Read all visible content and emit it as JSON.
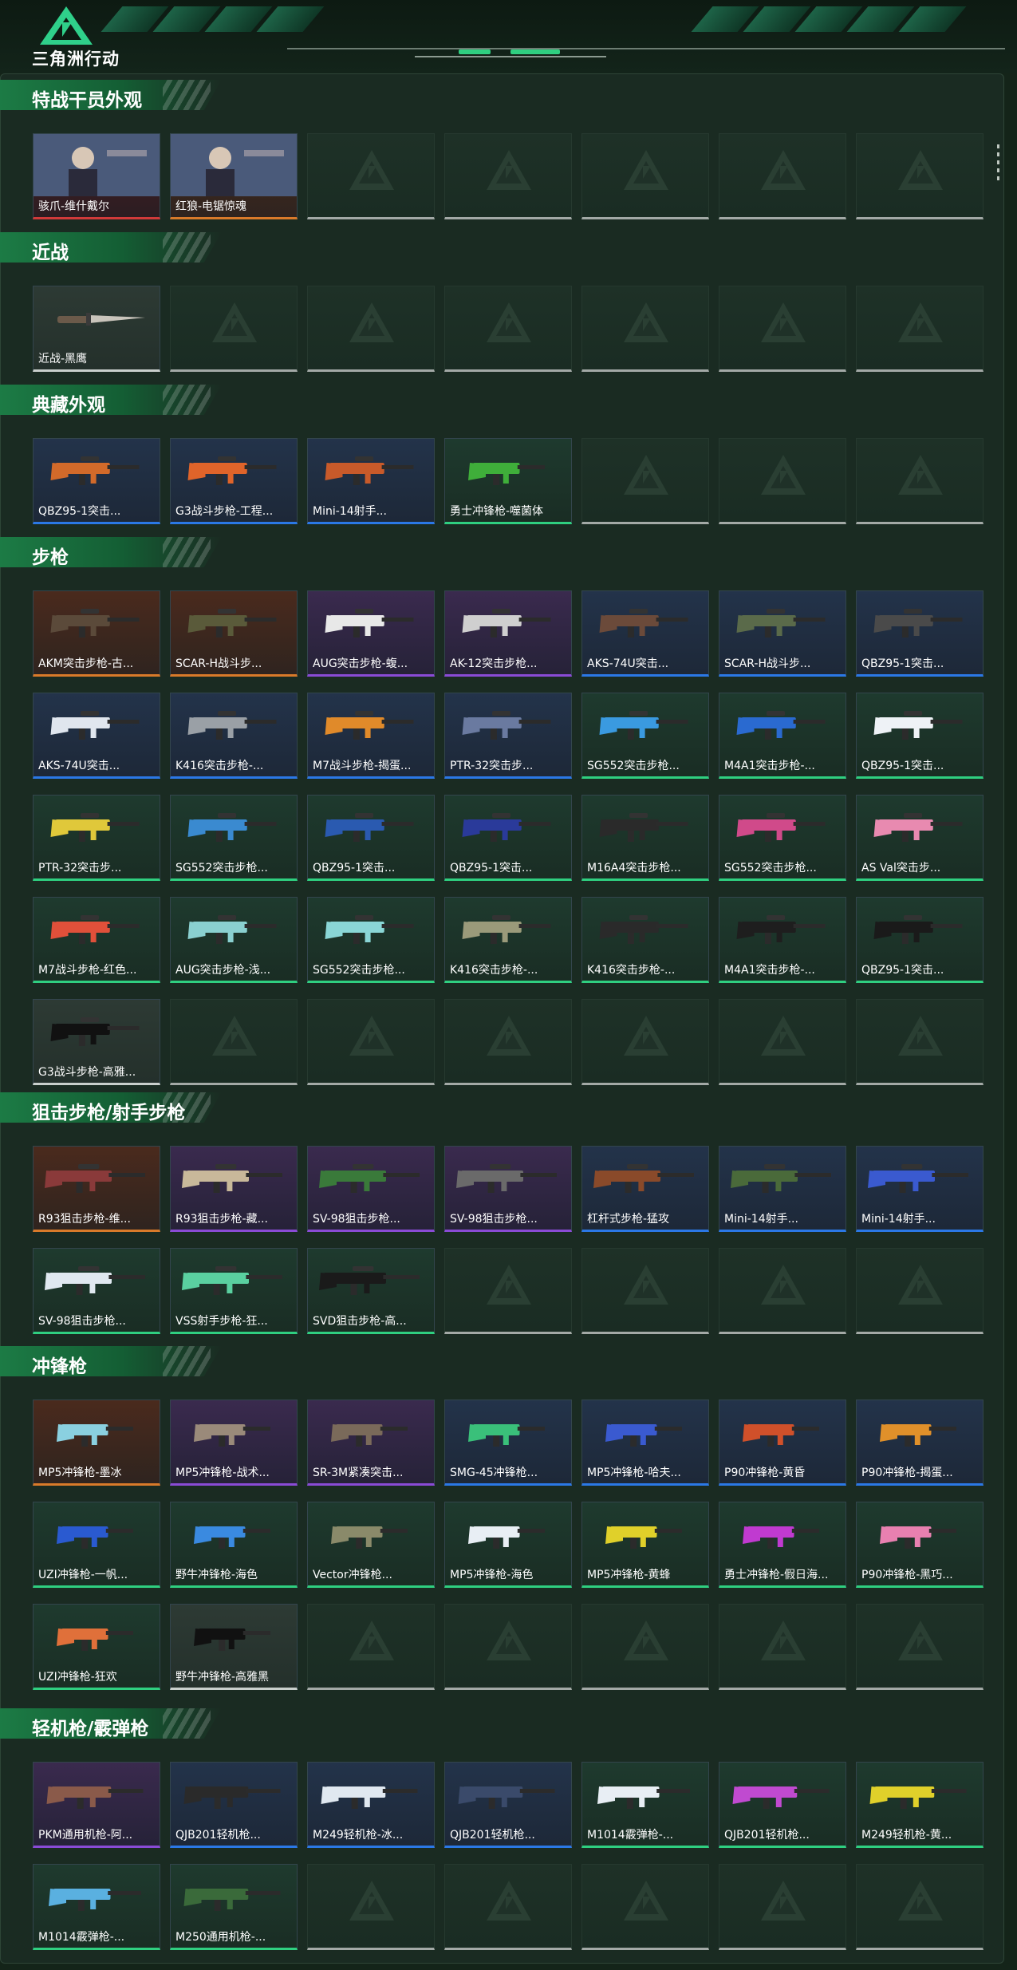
{
  "brand": {
    "name": "三角洲行动"
  },
  "colors": {
    "gold": "#d97a2a",
    "red": "#d13a3a",
    "purple": "#8a4bd6",
    "blue": "#2b78e6",
    "green": "#2fcf80",
    "white": "#c9cfcc",
    "empty": "#a3a9a6",
    "accent": "#1c7b45"
  },
  "sections": [
    {
      "title": "特战干员外观",
      "slots": 7,
      "items": [
        {
          "label": "骇爪-维什戴尔",
          "rarity": "red",
          "kind": "portrait"
        },
        {
          "label": "红狼-电锯惊魂",
          "rarity": "gold",
          "kind": "portrait"
        }
      ]
    },
    {
      "title": "近战",
      "slots": 7,
      "items": [
        {
          "label": "近战-黑鹰",
          "rarity": "white",
          "kind": "knife"
        }
      ]
    },
    {
      "title": "典藏外观",
      "slots": 7,
      "items": [
        {
          "label": "QBZ95-1突击...",
          "rarity": "blue",
          "kind": "rifle",
          "tint": "#d26a2a"
        },
        {
          "label": "G3战斗步枪-工程...",
          "rarity": "blue",
          "kind": "rifle",
          "tint": "#e0642a"
        },
        {
          "label": "Mini-14射手...",
          "rarity": "blue",
          "kind": "rifle",
          "tint": "#c85a2a"
        },
        {
          "label": "勇士冲锋枪-噬菌体",
          "rarity": "green",
          "kind": "smg",
          "tint": "#3fae3a"
        }
      ]
    },
    {
      "title": "步枪",
      "slots": 35,
      "items": [
        {
          "label": "AKM突击步枪-古...",
          "rarity": "gold",
          "kind": "rifle",
          "tint": "#5b4a3a"
        },
        {
          "label": "SCAR-H战斗步...",
          "rarity": "gold",
          "kind": "rifle",
          "tint": "#5a5a3a"
        },
        {
          "label": "AUG突击步枪-蝮...",
          "rarity": "purple",
          "kind": "rifle",
          "tint": "#e8e8e8"
        },
        {
          "label": "AK-12突击步枪...",
          "rarity": "purple",
          "kind": "rifle",
          "tint": "#cfcfcf"
        },
        {
          "label": "AKS-74U突击...",
          "rarity": "blue",
          "kind": "rifle",
          "tint": "#6b4a3a"
        },
        {
          "label": "SCAR-H战斗步...",
          "rarity": "blue",
          "kind": "rifle",
          "tint": "#5a6a4a"
        },
        {
          "label": "QBZ95-1突击...",
          "rarity": "blue",
          "kind": "rifle",
          "tint": "#4a4a4a"
        },
        {
          "label": "AKS-74U突击...",
          "rarity": "blue",
          "kind": "rifle",
          "tint": "#e0e6ee"
        },
        {
          "label": "K416突击步枪-...",
          "rarity": "blue",
          "kind": "rifle",
          "tint": "#9aa0a6"
        },
        {
          "label": "M7战斗步枪-揭蛋...",
          "rarity": "blue",
          "kind": "rifle",
          "tint": "#e08a2a"
        },
        {
          "label": "PTR-32突击步...",
          "rarity": "blue",
          "kind": "rifle",
          "tint": "#6a7aa0"
        },
        {
          "label": "SG552突击步枪...",
          "rarity": "green",
          "kind": "rifle",
          "tint": "#3a9ae0"
        },
        {
          "label": "M4A1突击步枪-...",
          "rarity": "green",
          "kind": "rifle",
          "tint": "#2a6ad0"
        },
        {
          "label": "QBZ95-1突击...",
          "rarity": "green",
          "kind": "rifle",
          "tint": "#eef2f6"
        },
        {
          "label": "PTR-32突击步...",
          "rarity": "green",
          "kind": "rifle",
          "tint": "#e0c83a"
        },
        {
          "label": "SG552突击步枪...",
          "rarity": "green",
          "kind": "rifle",
          "tint": "#3a8ad0"
        },
        {
          "label": "QBZ95-1突击...",
          "rarity": "green",
          "kind": "rifle",
          "tint": "#2a5ab0"
        },
        {
          "label": "QBZ95-1突击...",
          "rarity": "green",
          "kind": "rifle",
          "tint": "#2a3a9a"
        },
        {
          "label": "M16A4突击步枪...",
          "rarity": "green",
          "kind": "rifle",
          "tint": "#2a2a2a"
        },
        {
          "label": "SG552突击步枪...",
          "rarity": "green",
          "kind": "rifle",
          "tint": "#d04a8a"
        },
        {
          "label": "AS Val突击步...",
          "rarity": "green",
          "kind": "rifle",
          "tint": "#e88ab0"
        },
        {
          "label": "M7战斗步枪-红色...",
          "rarity": "green",
          "kind": "rifle",
          "tint": "#e0503a"
        },
        {
          "label": "AUG突击步枪-浅...",
          "rarity": "green",
          "kind": "rifle",
          "tint": "#8ad0d0"
        },
        {
          "label": "SG552突击步枪...",
          "rarity": "green",
          "kind": "rifle",
          "tint": "#8ad6d6"
        },
        {
          "label": "K416突击步枪-...",
          "rarity": "green",
          "kind": "rifle",
          "tint": "#9a9a7a"
        },
        {
          "label": "K416突击步枪-...",
          "rarity": "green",
          "kind": "rifle",
          "tint": "#2a2a2a"
        },
        {
          "label": "M4A1突击步枪-...",
          "rarity": "green",
          "kind": "rifle",
          "tint": "#1e1e1e"
        },
        {
          "label": "QBZ95-1突击...",
          "rarity": "green",
          "kind": "rifle",
          "tint": "#1a1a1a"
        },
        {
          "label": "G3战斗步枪-高雅...",
          "rarity": "white",
          "kind": "rifle",
          "tint": "#111111"
        }
      ]
    },
    {
      "title": "狙击步枪/射手步枪",
      "slots": 14,
      "items": [
        {
          "label": "R93狙击步枪-维...",
          "rarity": "gold",
          "kind": "sniper",
          "tint": "#8a3a3a"
        },
        {
          "label": "R93狙击步枪-藏...",
          "rarity": "purple",
          "kind": "sniper",
          "tint": "#c8b89a"
        },
        {
          "label": "SV-98狙击步枪...",
          "rarity": "purple",
          "kind": "sniper",
          "tint": "#3a7a3a"
        },
        {
          "label": "SV-98狙击步枪...",
          "rarity": "purple",
          "kind": "sniper",
          "tint": "#6a6a6a"
        },
        {
          "label": "杠杆式步枪-猛攻",
          "rarity": "blue",
          "kind": "sniper",
          "tint": "#8a4a2a"
        },
        {
          "label": "Mini-14射手...",
          "rarity": "blue",
          "kind": "sniper",
          "tint": "#4a6a3a"
        },
        {
          "label": "Mini-14射手...",
          "rarity": "blue",
          "kind": "sniper",
          "tint": "#3a5ad0"
        },
        {
          "label": "SV-98狙击步枪...",
          "rarity": "green",
          "kind": "sniper",
          "tint": "#e0e8f0"
        },
        {
          "label": "VSS射手步枪-狂...",
          "rarity": "green",
          "kind": "sniper",
          "tint": "#5ad0a0"
        },
        {
          "label": "SVD狙击步枪-高...",
          "rarity": "green",
          "kind": "sniper",
          "tint": "#1a1a1a"
        }
      ]
    },
    {
      "title": "冲锋枪",
      "slots": 21,
      "items": [
        {
          "label": "MP5冲锋枪-墨冰",
          "rarity": "gold",
          "kind": "smg",
          "tint": "#8ad0e0"
        },
        {
          "label": "MP5冲锋枪-战术...",
          "rarity": "purple",
          "kind": "smg",
          "tint": "#9a8a7a"
        },
        {
          "label": "SR-3M紧凑突击...",
          "rarity": "purple",
          "kind": "smg",
          "tint": "#7a6a5a"
        },
        {
          "label": "SMG-45冲锋枪...",
          "rarity": "blue",
          "kind": "smg",
          "tint": "#3ac07a"
        },
        {
          "label": "MP5冲锋枪-哈夫...",
          "rarity": "blue",
          "kind": "smg",
          "tint": "#3a5ad0"
        },
        {
          "label": "P90冲锋枪-黄昏",
          "rarity": "blue",
          "kind": "smg",
          "tint": "#d0502a"
        },
        {
          "label": "P90冲锋枪-揭蛋...",
          "rarity": "blue",
          "kind": "smg",
          "tint": "#e0902a"
        },
        {
          "label": "UZI冲锋枪-一帆...",
          "rarity": "green",
          "kind": "smg",
          "tint": "#2a5ad0"
        },
        {
          "label": "野牛冲锋枪-海色",
          "rarity": "green",
          "kind": "smg",
          "tint": "#3a8ae0"
        },
        {
          "label": "Vector冲锋枪...",
          "rarity": "green",
          "kind": "smg",
          "tint": "#8a8a6a"
        },
        {
          "label": "MP5冲锋枪-海色",
          "rarity": "green",
          "kind": "smg",
          "tint": "#e8eef4"
        },
        {
          "label": "MP5冲锋枪-黄蜂",
          "rarity": "green",
          "kind": "smg",
          "tint": "#e0d02a"
        },
        {
          "label": "勇士冲锋枪-假日海...",
          "rarity": "green",
          "kind": "smg",
          "tint": "#c03ad0"
        },
        {
          "label": "P90冲锋枪-黑巧...",
          "rarity": "green",
          "kind": "smg",
          "tint": "#e880b0"
        },
        {
          "label": "UZI冲锋枪-狂欢",
          "rarity": "green",
          "kind": "smg",
          "tint": "#e0703a"
        },
        {
          "label": "野牛冲锋枪-高雅黑",
          "rarity": "white",
          "kind": "smg",
          "tint": "#111111"
        }
      ]
    },
    {
      "title": "轻机枪/霰弹枪",
      "slots": 14,
      "items": [
        {
          "label": "PKM通用机枪-阿...",
          "rarity": "purple",
          "kind": "lmg",
          "tint": "#8a5a4a"
        },
        {
          "label": "QJB201轻机枪...",
          "rarity": "blue",
          "kind": "lmg",
          "tint": "#2a2a2a"
        },
        {
          "label": "M249轻机枪-冰...",
          "rarity": "blue",
          "kind": "lmg",
          "tint": "#e0e8f0"
        },
        {
          "label": "QJB201轻机枪...",
          "rarity": "blue",
          "kind": "lmg",
          "tint": "#3a4a6a"
        },
        {
          "label": "M1014霰弹枪-...",
          "rarity": "green",
          "kind": "shotgun",
          "tint": "#e8eef4"
        },
        {
          "label": "QJB201轻机枪...",
          "rarity": "green",
          "kind": "lmg",
          "tint": "#c04ad0"
        },
        {
          "label": "M249轻机枪-黄...",
          "rarity": "green",
          "kind": "lmg",
          "tint": "#e0d02a"
        },
        {
          "label": "M1014霰弹枪-...",
          "rarity": "green",
          "kind": "shotgun",
          "tint": "#5ab0e0"
        },
        {
          "label": "M250通用机枪-...",
          "rarity": "green",
          "kind": "lmg",
          "tint": "#3a6a3a"
        }
      ]
    }
  ]
}
